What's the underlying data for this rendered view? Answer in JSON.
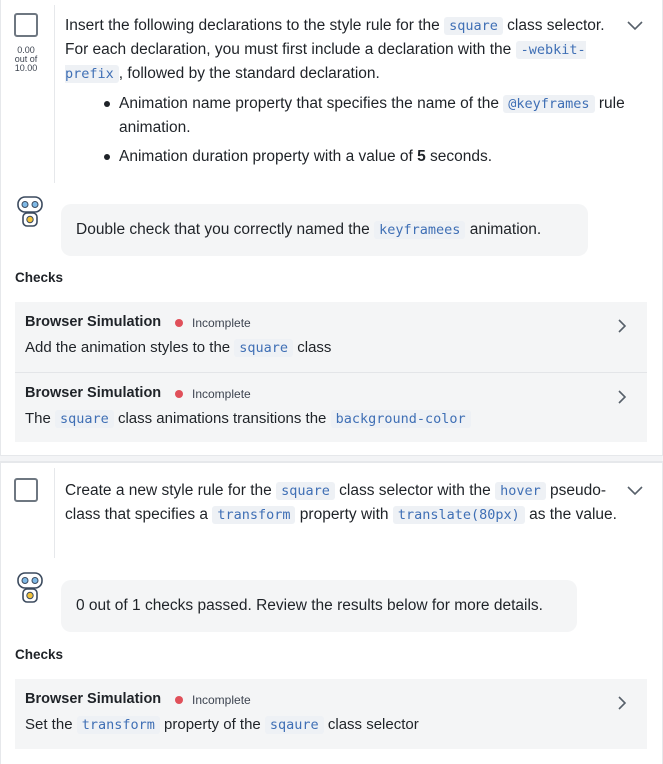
{
  "tasks": [
    {
      "score": {
        "value": "0.00",
        "out_of_label": "out of",
        "total": "10.00"
      },
      "instruction": {
        "line1_pre": "Insert the following declarations to the style rule for the ",
        "code_square": "square",
        "line1_post": " class selector. For each declaration, you must first include a declaration with the ",
        "code_prefix": "-webkit- prefix",
        "line2_post": ", followed by the standard declaration."
      },
      "bullets": [
        {
          "pre": "Animation name property that specifies the name of the ",
          "code": "@keyframes",
          "post": " rule animation."
        },
        {
          "pre": "Animation duration property with a value of ",
          "bold": "5",
          "post": " seconds."
        }
      ],
      "hint": {
        "pre": "Double check that you correctly named the ",
        "code": "keyframees",
        "post": " animation."
      },
      "checks_label": "Checks",
      "checks": [
        {
          "title": "Browser Simulation",
          "status": "Incomplete",
          "desc_pre": "Add the animation styles to the ",
          "desc_code": "square",
          "desc_post": " class"
        },
        {
          "title": "Browser Simulation",
          "status": "Incomplete",
          "desc_pre": "The ",
          "desc_code": "square",
          "desc_mid": " class animations transitions the ",
          "desc_code2": "background-color"
        }
      ]
    },
    {
      "instruction": {
        "pre": "Create a new style rule for the ",
        "code_square": "square",
        "mid": " class selector with the ",
        "code_hover": "hover",
        "mid2": " pseudo-class that specifies a ",
        "code_transform": "transform",
        "mid3": " property with ",
        "code_value": "translate(80px)",
        "post": " as the value."
      },
      "hint": {
        "text": "0 out of 1 checks passed. Review the results below for more details."
      },
      "checks_label": "Checks",
      "checks": [
        {
          "title": "Browser Simulation",
          "status": "Incomplete",
          "desc_pre": "Set the ",
          "desc_code": "transform",
          "desc_mid": " property of the ",
          "desc_code2": "sqaure",
          "desc_post": " class selector"
        }
      ]
    }
  ],
  "colors": {
    "status_dot": "#e0505a",
    "code_text": "#3f6fb5",
    "code_bg": "#eef1f5",
    "card_bg": "#f4f5f6"
  },
  "icons": {
    "collapse": "chevron-down-icon",
    "open_check": "chevron-right-icon",
    "assistant": "robot-icon"
  }
}
